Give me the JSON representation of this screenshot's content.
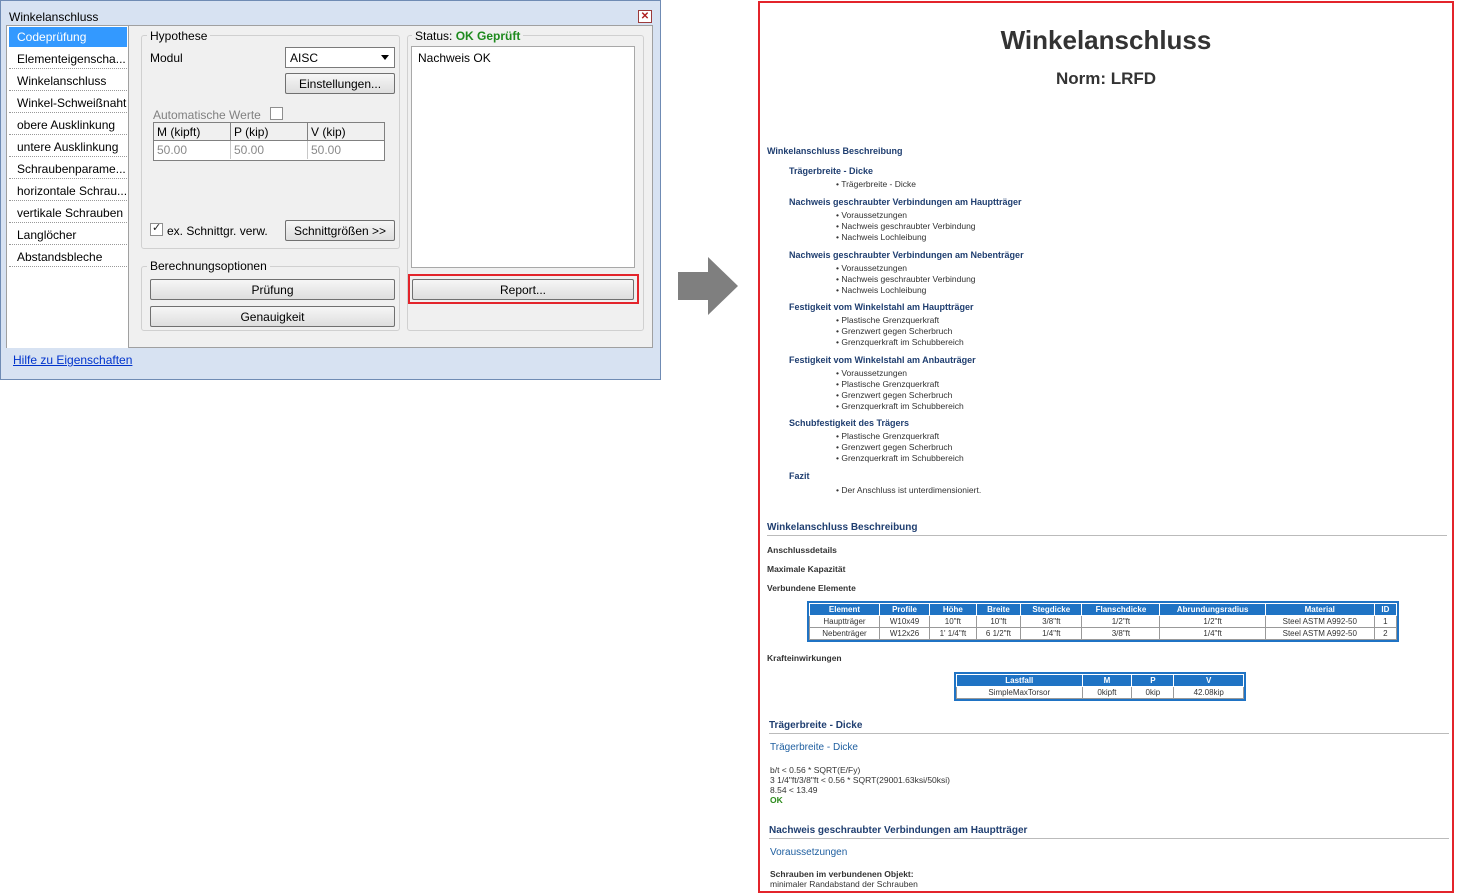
{
  "dialog": {
    "title": "Winkelanschluss",
    "nav": [
      "Codeprüfung",
      "Elementeigenscha...",
      "Winkelanschluss",
      "Winkel-Schweißnaht",
      "obere Ausklinkung",
      "untere Ausklinkung",
      "Schraubenparame...",
      "horizontale Schrau...",
      "vertikale Schrauben",
      "Langlöcher",
      "Abstandsbleche"
    ],
    "hypothese": {
      "group_label": "Hypothese",
      "modul_label": "Modul",
      "modul_value": "AISC",
      "settings_button": "Einstellungen...",
      "auto_label": "Automatische Werte",
      "table_headers": [
        "M (kipft)",
        "P (kip)",
        "V (kip)"
      ],
      "table_values": [
        "50.00",
        "50.00",
        "50.00"
      ],
      "ex_label": "ex. Schnittgr. verw.",
      "schnitt_button": "Schnittgrößen >>"
    },
    "berechnung": {
      "group_label": "Berechnungsoptionen",
      "check_button": "Prüfung",
      "accuracy_button": "Genauigkeit"
    },
    "status": {
      "label": "Status:",
      "value": "OK Geprüft",
      "text": "Nachweis OK",
      "report_button": "Report..."
    },
    "help_link": "Hilfe zu Eigenschaften"
  },
  "report": {
    "title": "Winkelanschluss",
    "subtitle": "Norm: LRFD",
    "toc_heading": "Winkelanschluss Beschreibung",
    "toc": [
      {
        "title": "Trägerbreite - Dicke",
        "items": [
          "Trägerbreite - Dicke"
        ]
      },
      {
        "title": "Nachweis geschraubter Verbindungen am Hauptträger",
        "items": [
          "Voraussetzungen",
          "Nachweis geschraubter Verbindung",
          "Nachweis Lochleibung"
        ]
      },
      {
        "title": "Nachweis geschraubter Verbindungen am Nebenträger",
        "items": [
          "Voraussetzungen",
          "Nachweis geschraubter Verbindung",
          "Nachweis Lochleibung"
        ]
      },
      {
        "title": "Festigkeit vom Winkelstahl am Hauptträger",
        "items": [
          "Plastische Grenzquerkraft",
          "Grenzwert gegen Scherbruch",
          "Grenzquerkraft im Schubbereich"
        ]
      },
      {
        "title": "Festigkeit vom Winkelstahl am Anbauträger",
        "items": [
          "Voraussetzungen",
          "Plastische Grenzquerkraft",
          "Grenzwert gegen Scherbruch",
          "Grenzquerkraft im Schubbereich"
        ]
      },
      {
        "title": "Schubfestigkeit des Trägers",
        "items": [
          "Plastische Grenzquerkraft",
          "Grenzwert gegen Scherbruch",
          "Grenzquerkraft im Schubbereich"
        ]
      },
      {
        "title": "Fazit",
        "items": [
          "Der Anschluss ist unterdimensioniert."
        ]
      }
    ],
    "section1": "Winkelanschluss Beschreibung",
    "anschluss": "Anschlussdetails",
    "maxkap": "Maximale Kapazität",
    "verbunden": "Verbundene Elemente",
    "elements_table": {
      "headers": [
        "Element",
        "Profile",
        "Höhe",
        "Breite",
        "Stegdicke",
        "Flanschdicke",
        "Abrundungsradius",
        "Material",
        "ID"
      ],
      "rows": [
        [
          "Hauptträger",
          "W10x49",
          "10\"ft",
          "10\"ft",
          "3/8\"ft",
          "1/2\"ft",
          "1/2\"ft",
          "Steel ASTM A992-50",
          "1"
        ],
        [
          "Nebenträger",
          "W12x26",
          "1' 1/4\"ft",
          "6 1/2\"ft",
          "1/4\"ft",
          "3/8\"ft",
          "1/4\"ft",
          "Steel ASTM A992-50",
          "2"
        ]
      ]
    },
    "krafte": "Krafteinwirkungen",
    "load_table": {
      "headers": [
        "Lastfall",
        "M",
        "P",
        "V"
      ],
      "rows": [
        [
          "SimpleMaxTorsor",
          "0kipft",
          "0kip",
          "42.08kip"
        ]
      ]
    },
    "section2": "Trägerbreite - Dicke",
    "section2_sub": "Trägerbreite - Dicke",
    "formula": [
      "b/t < 0.56 * SQRT(E/Fy)",
      "3 1/4\"ft/3/8\"ft < 0.56 * SQRT(29001.63ksi/50ksi)",
      "8.54 < 13.49"
    ],
    "formula_ok": "OK",
    "section3": "Nachweis geschraubter Verbindungen am Hauptträger",
    "section3_sub": "Voraussetzungen",
    "bolts_bold": "Schrauben im verbundenen Objekt:",
    "bolts_line": "minimaler Randabstand der Schrauben"
  },
  "colors": {
    "accent": "#3399ff",
    "highlight": "#e3242b",
    "ok": "#1e8a1e",
    "report_header": "#1f73c4"
  }
}
